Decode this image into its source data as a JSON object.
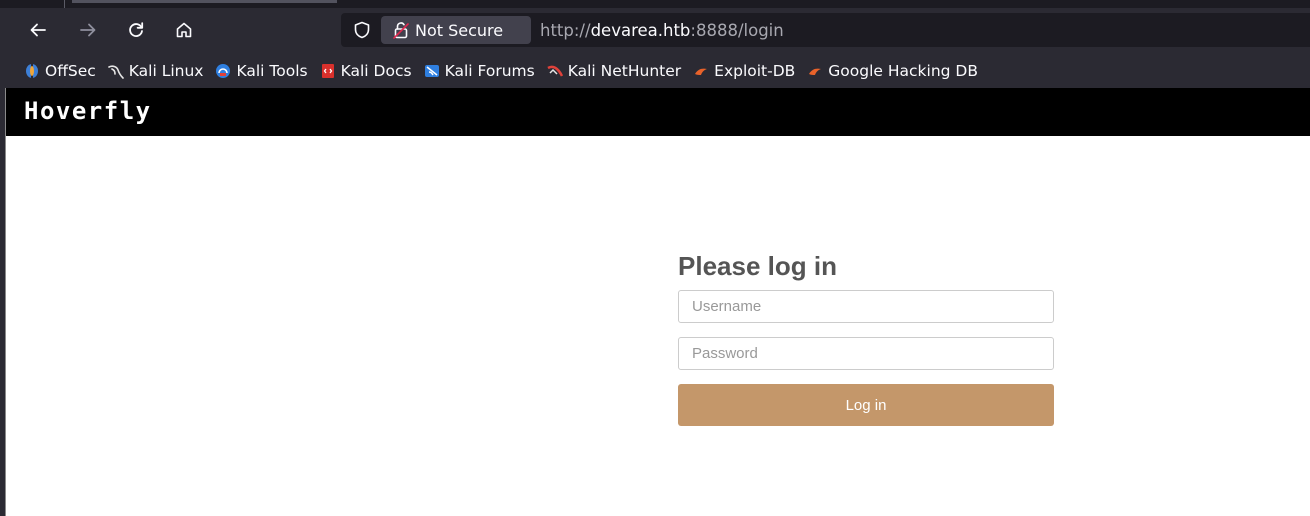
{
  "browser": {
    "security_label": "Not Secure",
    "url_scheme": "http://",
    "url_host": "devarea.htb",
    "url_rest": ":8888/login",
    "bookmarks": [
      {
        "label": "OffSec",
        "icon": "offsec-icon"
      },
      {
        "label": "Kali Linux",
        "icon": "kali-dragon-icon"
      },
      {
        "label": "Kali Tools",
        "icon": "kali-tools-icon"
      },
      {
        "label": "Kali Docs",
        "icon": "kali-docs-icon"
      },
      {
        "label": "Kali Forums",
        "icon": "kali-forums-icon"
      },
      {
        "label": "Kali NetHunter",
        "icon": "kali-nethunter-icon"
      },
      {
        "label": "Exploit-DB",
        "icon": "exploit-db-icon"
      },
      {
        "label": "Google Hacking DB",
        "icon": "google-hacking-db-icon"
      }
    ]
  },
  "app": {
    "brand": "Hoverfly"
  },
  "login": {
    "title": "Please log in",
    "username_placeholder": "Username",
    "password_placeholder": "Password",
    "submit_label": "Log in"
  },
  "colors": {
    "browser_chrome": "#2b2a33",
    "url_field": "#1c1b22",
    "header": "#000000",
    "button": "#c4976a"
  }
}
